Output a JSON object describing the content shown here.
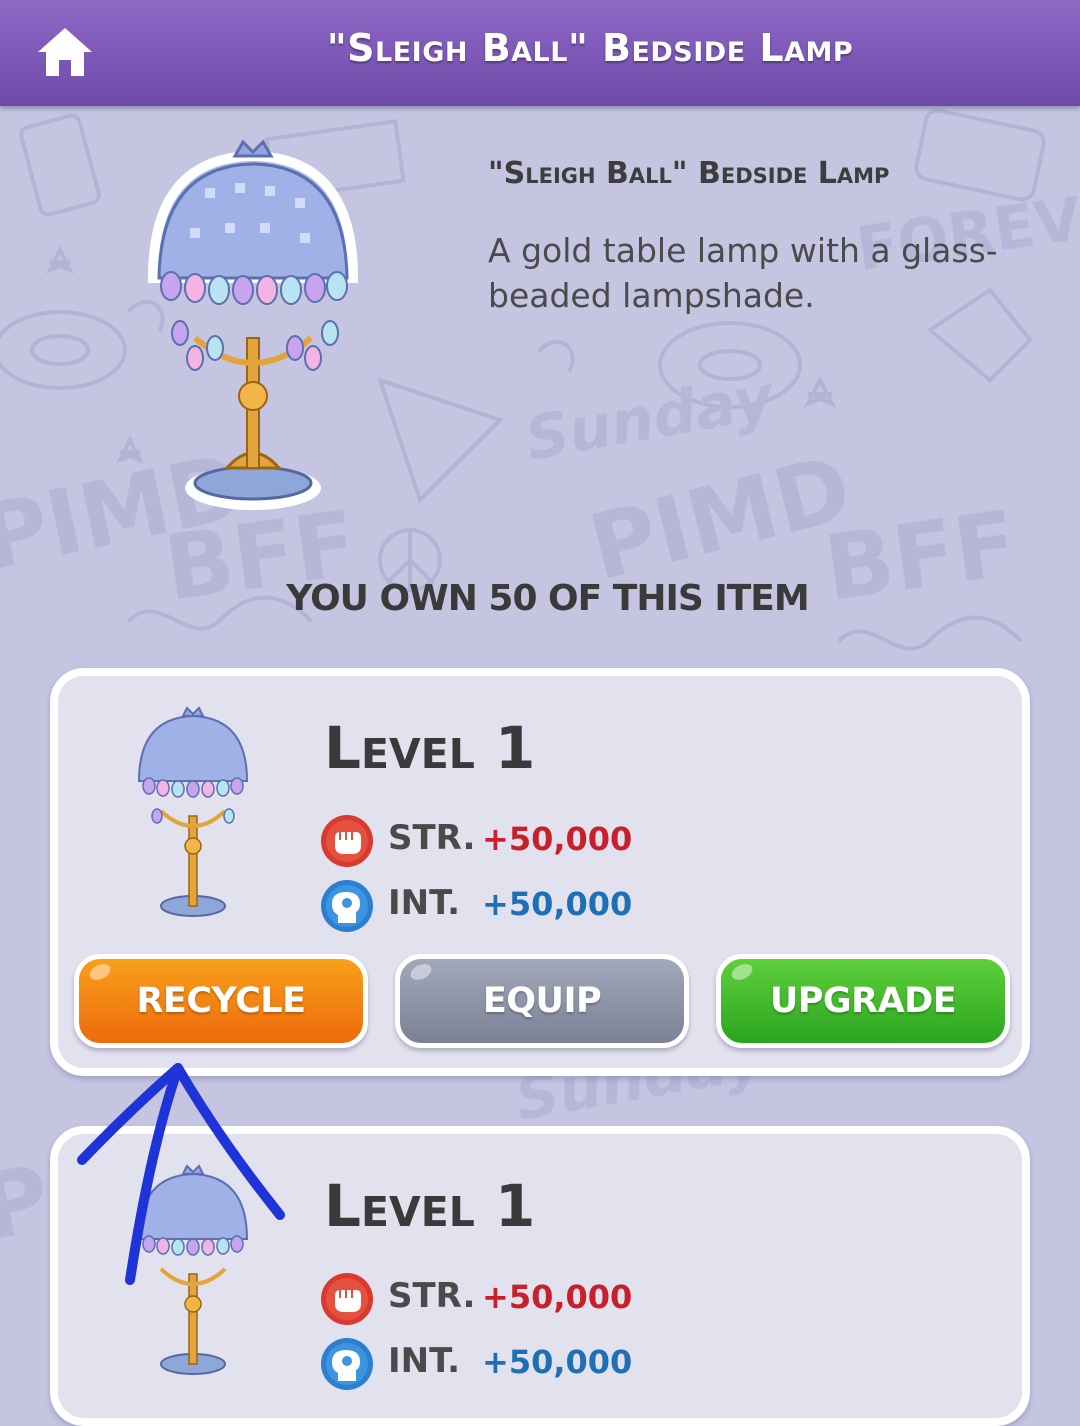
{
  "header": {
    "title": "\"Sleigh Ball\" Bedside Lamp",
    "home_icon": "home-icon"
  },
  "item": {
    "name": "\"Sleigh Ball\" Bedside Lamp",
    "description": "A gold table lamp with a glass-beaded lampshade.",
    "own_count_text": "YOU OWN 50 OF THIS ITEM"
  },
  "background_doodle_text": [
    "PIMD",
    "BFF",
    "Sunday",
    "FOREVER"
  ],
  "cards": [
    {
      "level_label": "Level 1",
      "stats": [
        {
          "label": "STR.",
          "value": "+50,000",
          "icon": "fist-icon",
          "color": "#c8202b"
        },
        {
          "label": "INT.",
          "value": "+50,000",
          "icon": "head-icon",
          "color": "#1e6fb6"
        }
      ],
      "buttons": {
        "recycle": "RECYCLE",
        "equip": "EQUIP",
        "upgrade": "UPGRADE"
      }
    },
    {
      "level_label": "Level 1",
      "stats": [
        {
          "label": "STR.",
          "value": "+50,000",
          "icon": "fist-icon",
          "color": "#c8202b"
        },
        {
          "label": "INT.",
          "value": "+50,000",
          "icon": "head-icon",
          "color": "#1e6fb6"
        }
      ]
    }
  ],
  "colors": {
    "header": "#7a55b3",
    "background": "#c5c5e2",
    "recycle": "#f28a12",
    "equip": "#8f95a9",
    "upgrade": "#3dba2b",
    "annotation": "#1f34d8"
  }
}
